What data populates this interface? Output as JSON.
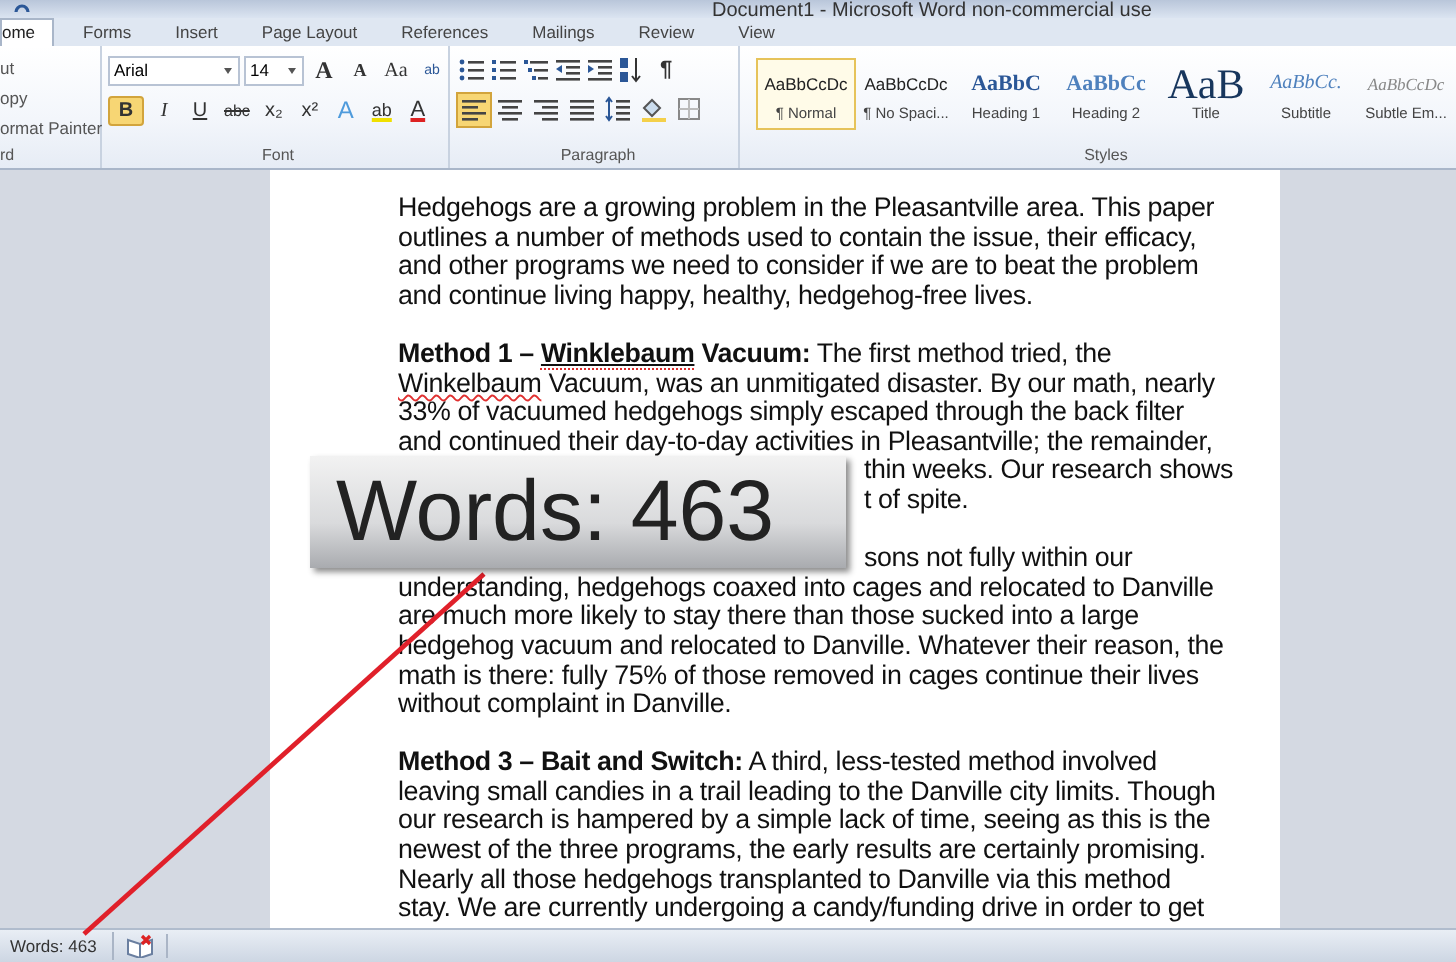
{
  "window": {
    "title": "Document1 - Microsoft Word non-commercial use"
  },
  "tabs": [
    {
      "label": "ome",
      "selected": true
    },
    {
      "label": "Forms",
      "selected": false
    },
    {
      "label": "Insert",
      "selected": false
    },
    {
      "label": "Page Layout",
      "selected": false
    },
    {
      "label": "References",
      "selected": false
    },
    {
      "label": "Mailings",
      "selected": false
    },
    {
      "label": "Review",
      "selected": false
    },
    {
      "label": "View",
      "selected": false
    }
  ],
  "ribbon": {
    "clipboard": {
      "items": [
        "ut",
        "opy",
        "ormat Painter"
      ],
      "label": "rd"
    },
    "font": {
      "font_name": "Arial",
      "font_size": "14",
      "row1": [
        {
          "kind": "grow",
          "label": "A"
        },
        {
          "kind": "shrink",
          "label": "A"
        },
        {
          "kind": "case",
          "label": "Aa"
        },
        {
          "kind": "clear",
          "label": "ab"
        }
      ],
      "row2": [
        {
          "kind": "bold",
          "label": "B",
          "selected": true
        },
        {
          "kind": "italic",
          "label": "I",
          "selected": false
        },
        {
          "kind": "underline",
          "label": "U",
          "selected": false
        },
        {
          "kind": "strike",
          "label": "abc",
          "selected": false
        },
        {
          "kind": "sub",
          "label": "x₂",
          "selected": false
        },
        {
          "kind": "sup",
          "label": "x²",
          "selected": false
        },
        {
          "kind": "effects",
          "label": "A",
          "selected": false
        },
        {
          "kind": "highlight",
          "label": "ab",
          "selected": false
        },
        {
          "kind": "color",
          "label": "A",
          "selected": false
        }
      ],
      "label": "Font"
    },
    "paragraph": {
      "row1": [
        {
          "kind": "bullets"
        },
        {
          "kind": "numbering"
        },
        {
          "kind": "multilevel"
        },
        {
          "kind": "outdent"
        },
        {
          "kind": "indent"
        },
        {
          "kind": "sort"
        },
        {
          "kind": "pilcrow",
          "label": "¶"
        }
      ],
      "row2": [
        {
          "kind": "align-left",
          "selected": true
        },
        {
          "kind": "align-center",
          "selected": false
        },
        {
          "kind": "align-right",
          "selected": false
        },
        {
          "kind": "justify",
          "selected": false
        },
        {
          "kind": "spacing",
          "selected": false
        },
        {
          "kind": "shading",
          "selected": false
        },
        {
          "kind": "borders",
          "selected": false
        }
      ],
      "label": "Paragraph"
    },
    "styles": {
      "items": [
        {
          "kind": "normal",
          "preview": "AaBbCcDc",
          "name": "¶ Normal",
          "selected": true
        },
        {
          "kind": "nospacing",
          "preview": "AaBbCcDc",
          "name": "¶ No Spaci...",
          "selected": false
        },
        {
          "kind": "heading1",
          "preview": "AaBbC",
          "name": "Heading 1",
          "selected": false
        },
        {
          "kind": "heading2",
          "preview": "AaBbCc",
          "name": "Heading 2",
          "selected": false
        },
        {
          "kind": "title",
          "preview": "AaB",
          "name": "Title",
          "selected": false
        },
        {
          "kind": "subtitle",
          "preview": "AaBbCc.",
          "name": "Subtitle",
          "selected": false
        },
        {
          "kind": "subtle",
          "preview": "AaBbCcDc",
          "name": "Subtle Em...",
          "selected": false
        }
      ],
      "label": "Styles"
    }
  },
  "document": {
    "paragraphs": [
      {
        "lines": [
          [
            {
              "text": "Hedgehogs are a growing problem in the Pleasantville area. This paper"
            }
          ],
          [
            {
              "text": "outlines a number of methods used to contain the issue, their efficacy,"
            }
          ],
          [
            {
              "text": "and other programs we need to consider if we are to beat the problem"
            }
          ],
          [
            {
              "text": "and continue living happy, healthy, hedgehog-free lives."
            }
          ]
        ]
      },
      {
        "lines": [
          [
            {
              "text": "Method 1 – ",
              "bold": true
            },
            {
              "text": "Winklebaum",
              "bold": true,
              "underline": true,
              "misspelled": true
            },
            {
              "text": " Vacuum:",
              "bold": true
            },
            {
              "text": " The first method tried, the"
            }
          ],
          [
            {
              "text": "Winkelbaum",
              "misspelled": true
            },
            {
              "text": " Vacuum, was an unmitigated disaster. By our math, nearly"
            }
          ],
          [
            {
              "text": "33% of vacuumed hedgehogs simply escaped through the back filter"
            }
          ],
          [
            {
              "text": "and continued their day-to-day activities in Pleasantville; the remainder,"
            }
          ],
          [
            {
              "text": "thin weeks. Our research shows",
              "covered": true
            }
          ],
          [
            {
              "text": "t of spite.",
              "covered": true
            }
          ]
        ]
      },
      {
        "lines": [
          [
            {
              "text": "sons not fully within our",
              "covered": true
            }
          ],
          [
            {
              "text": "understanding, hedgehogs coaxed into cages and relocated to Danville"
            }
          ],
          [
            {
              "text": "are much more likely to stay there than those sucked into a large"
            }
          ],
          [
            {
              "text": "hedgehog vacuum and relocated to Danville. Whatever their reason, the"
            }
          ],
          [
            {
              "text": "math is there: fully 75% of those removed in cages continue their lives"
            }
          ],
          [
            {
              "text": "without complaint in Danville."
            }
          ]
        ]
      },
      {
        "lines": [
          [
            {
              "text": "Method 3 – Bait and Switch:",
              "bold": true
            },
            {
              "text": " A third, less-tested method involved"
            }
          ],
          [
            {
              "text": "leaving small candies in a trail leading to the Danville city limits. Though"
            }
          ],
          [
            {
              "text": "our research is hampered by a simple lack of time, seeing as this is the"
            }
          ],
          [
            {
              "text": "newest of the three programs, the early results are certainly promising."
            }
          ],
          [
            {
              "text": "Nearly all those hedgehogs transplanted to Danville via this method"
            }
          ],
          [
            {
              "text": "stay. We are currently undergoing a candy/funding drive in order to get"
            }
          ]
        ]
      }
    ]
  },
  "callout": {
    "text": "Words: 463"
  },
  "status_bar": {
    "word_count": "Words: 463"
  }
}
